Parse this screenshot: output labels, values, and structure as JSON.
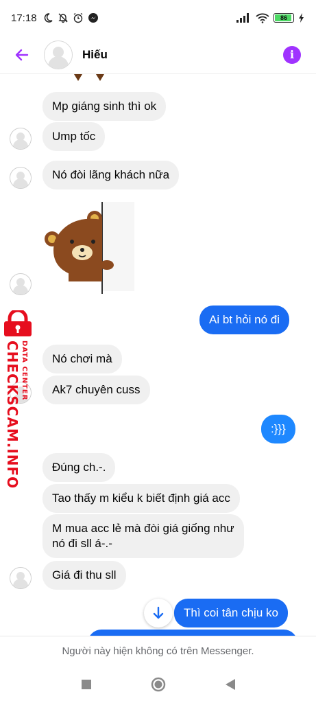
{
  "status_bar": {
    "time": "17:18",
    "battery": "86"
  },
  "header": {
    "contact_name": "Hiếu",
    "info_symbol": "i"
  },
  "messages": [
    {
      "text": "Mp giáng sinh thì ok"
    },
    {
      "text": "Ump tốc"
    },
    {
      "text": "Nó đòi lãng khách nữa"
    },
    {
      "text": "Ai bt hỏi nó đi"
    },
    {
      "text": "Nó chơi mà"
    },
    {
      "text": "Ak7 chuyên cuss"
    },
    {
      "text": ":}}}"
    },
    {
      "text": "Đúng ch.-."
    },
    {
      "text": "Tao thấy m kiểu k biết định giá acc"
    },
    {
      "text_line1": "M mua acc lẻ mà đòi giá giống như",
      "text_line2": "nó đi sll á-.-"
    },
    {
      "text": "Giá đi thu sll"
    },
    {
      "text": "Thì coi tân chịu ko"
    }
  ],
  "watermark": {
    "main": "CHECKSCAM.INFO",
    "sub": "DATA CENTER"
  },
  "footer": {
    "notice": "Người này hiện không có trên Messenger."
  },
  "colors": {
    "accent": "#a033ff",
    "outgoing": "#1a6cf3",
    "incoming": "#f0f0f0",
    "watermark": "#e60e1e"
  },
  "icons": [
    "back-arrow-icon",
    "info-icon",
    "sticker-bear",
    "arrow-down-icon",
    "lock-icon",
    "nav-square-icon",
    "nav-circle-icon",
    "nav-triangle-icon"
  ]
}
